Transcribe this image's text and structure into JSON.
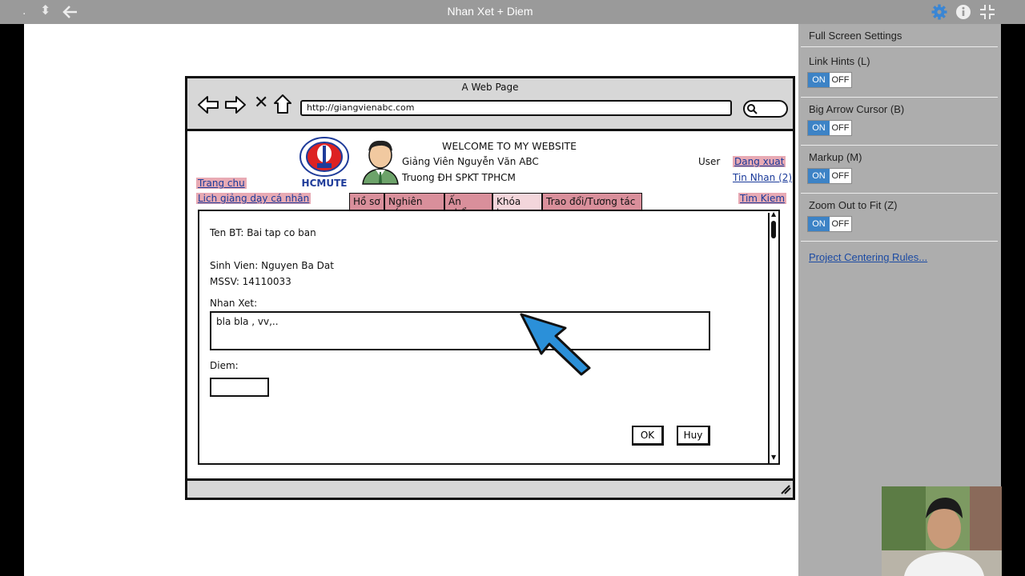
{
  "viewer": {
    "title": "Nhan Xet + Diem",
    "left_icons": [
      "up-down-arrows-icon",
      "back-arrow-icon"
    ],
    "right_icons": [
      "gear-icon",
      "info-icon",
      "exit-fullscreen-icon"
    ]
  },
  "mockup": {
    "window_title": "A Web Page",
    "url": "http://giangvienabc.com",
    "welcome": "WELCOME TO MY WEBSITE",
    "logo_text": "HCMUTE",
    "teacher_name": "Giảng Viên Nguyễn Văn ABC",
    "school": "Truong ĐH SPKT TPHCM",
    "user_label": "User",
    "logout": "Dang xuat",
    "messages": "Tin Nhan (2)",
    "search": "Tim Kiem",
    "left_links": [
      "Trang chu",
      "Lich giảng dạy cá nhân"
    ],
    "tabs": [
      "Hồ sơ",
      "Nghiên cứu",
      "Ấn phẩm",
      "Khóa học",
      "Trao đổi/Tương tác"
    ],
    "active_tab": "Khóa học",
    "form": {
      "exercise": "Ten BT: Bai tap co ban",
      "student": "Sinh Vien: Nguyen Ba Dat",
      "student_id": "MSSV: 14110033",
      "comment_label": "Nhan Xet:",
      "comment_value": "bla bla  , vv,..",
      "score_label": "Diem:",
      "score_value": "",
      "ok": "OK",
      "cancel": "Huy"
    }
  },
  "settings": {
    "header": "Full Screen Settings",
    "items": [
      {
        "label": "Link Hints (L)",
        "on": "ON",
        "off": "OFF"
      },
      {
        "label": "Big Arrow Cursor (B)",
        "on": "ON",
        "off": "OFF"
      },
      {
        "label": "Markup (M)",
        "on": "ON",
        "off": "OFF"
      },
      {
        "label": "Zoom Out to Fit (Z)",
        "on": "ON",
        "off": "OFF"
      }
    ],
    "rules_link": "Project Centering Rules..."
  },
  "colors": {
    "toggle_on": "#3d83c6",
    "tab_pink": "#d98f9b",
    "cursor_blue": "#2b90d9"
  }
}
